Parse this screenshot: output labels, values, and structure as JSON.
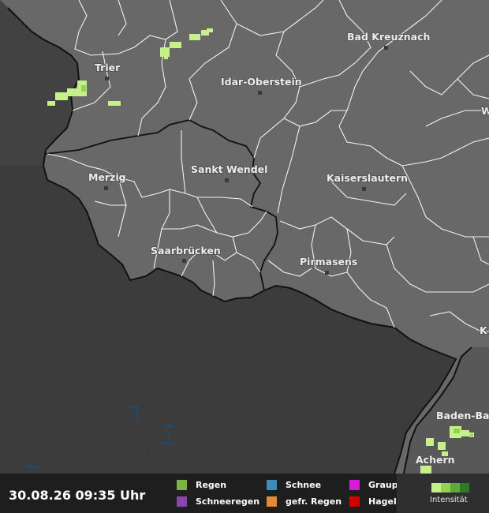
{
  "map": {
    "cities": [
      {
        "name": "Trier"
      },
      {
        "name": "Bad Kreuznach"
      },
      {
        "name": "Idar-Oberstein"
      },
      {
        "name": "Merzig"
      },
      {
        "name": "Sankt Wendel"
      },
      {
        "name": "Kaiserslautern"
      },
      {
        "name": "Saarbrücken"
      },
      {
        "name": "Pirmasens"
      },
      {
        "name": "Baden-Ba"
      },
      {
        "name": "Achern"
      }
    ],
    "edge_labels": [
      "W",
      "K"
    ]
  },
  "footer": {
    "timestamp": "30.08.26 09:35 Uhr",
    "legend": [
      {
        "label": "Regen",
        "color": "#7cb342"
      },
      {
        "label": "Schneeregen",
        "color": "#8e44ad"
      },
      {
        "label": "Schnee",
        "color": "#3c8dbc"
      },
      {
        "label": "gefr. Regen",
        "color": "#e08a3c"
      },
      {
        "label": "Graupel",
        "color": "#d81bd8"
      },
      {
        "label": "Hagel",
        "color": "#d40000"
      }
    ],
    "intensity_label": "Intensität",
    "intensity_colors": [
      "#c5f08a",
      "#94d150",
      "#5fa83a",
      "#2f7a25"
    ]
  },
  "colors": {
    "land": "#686868",
    "outside": "#3c3c3c",
    "border": "#111111",
    "district": "#ffffff",
    "rain_light": "#c5f08a",
    "water": "#1f4a6e"
  }
}
